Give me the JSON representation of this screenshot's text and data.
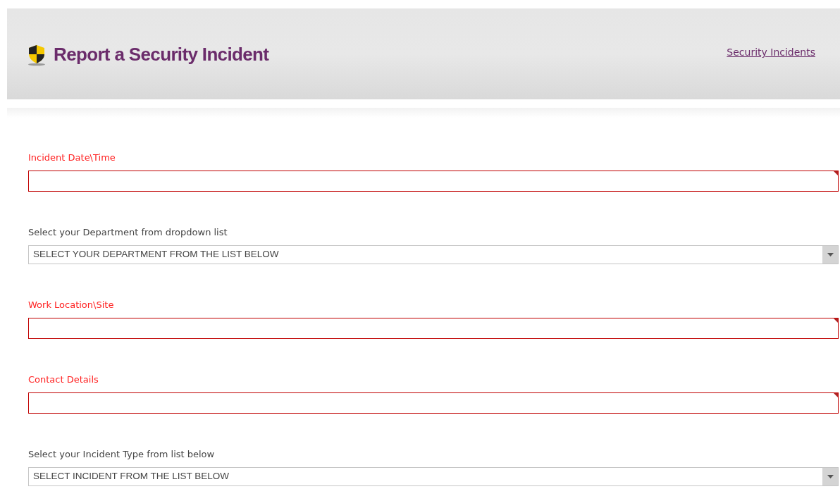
{
  "header": {
    "title": "Report a Security Incident",
    "link": "Security Incidents"
  },
  "fields": [
    {
      "kind": "text",
      "label": "Incident Date\\Time",
      "required": true
    },
    {
      "kind": "select",
      "label": "Select your Department from dropdown list",
      "required": false,
      "value": "SELECT YOUR DEPARTMENT FROM THE LIST BELOW"
    },
    {
      "kind": "text",
      "label": "Work Location\\Site",
      "required": true
    },
    {
      "kind": "text",
      "label": "Contact Details",
      "required": true
    },
    {
      "kind": "select",
      "label": "Select your Incident Type from list below",
      "required": false,
      "value": "SELECT INCIDENT FROM THE LIST BELOW"
    }
  ]
}
